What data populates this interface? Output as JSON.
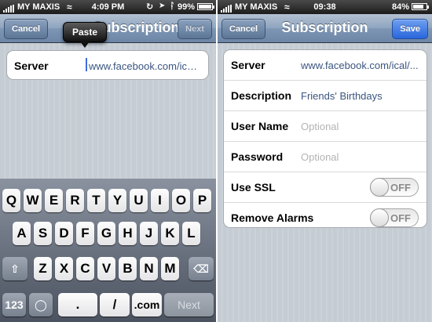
{
  "left": {
    "status": {
      "carrier": "MY MAXIS",
      "time": "4:09 PM",
      "battery": "99%"
    },
    "nav": {
      "title": "Subscription",
      "cancel": "Cancel",
      "next": "Next"
    },
    "server": {
      "label": "Server",
      "value": "www.facebook.com/ical/b.p"
    },
    "paste": "Paste",
    "keyboard": {
      "row1": [
        "Q",
        "W",
        "E",
        "R",
        "T",
        "Y",
        "U",
        "I",
        "O",
        "P"
      ],
      "row2": [
        "A",
        "S",
        "D",
        "F",
        "G",
        "H",
        "J",
        "K",
        "L"
      ],
      "row3": [
        "Z",
        "X",
        "C",
        "V",
        "B",
        "N",
        "M"
      ],
      "numbers": "123",
      "dot": ".",
      "slash": "/",
      "dotcom": ".com",
      "next": "Next"
    }
  },
  "right": {
    "status": {
      "carrier": "MY MAXIS",
      "time": "09:38",
      "battery": "84%"
    },
    "nav": {
      "cancel": "Cancel",
      "title": "Subscription",
      "save": "Save"
    },
    "fields": {
      "server": {
        "label": "Server",
        "value": "www.facebook.com/ical/..."
      },
      "description": {
        "label": "Description",
        "value": "Friends' Birthdays"
      },
      "username": {
        "label": "User Name",
        "placeholder": "Optional"
      },
      "password": {
        "label": "Password",
        "placeholder": "Optional"
      },
      "ssl": {
        "label": "Use SSL",
        "state": "OFF"
      },
      "alarms": {
        "label": "Remove Alarms",
        "state": "OFF"
      }
    }
  },
  "icons": {
    "wifi": "wifi-icon",
    "battery": "battery-icon",
    "bluetooth": "bluetooth-icon",
    "lock": "orientation-lock-icon",
    "delete": "delete-key-icon",
    "shift": "shift-key-icon",
    "globe": "globe-icon"
  },
  "colors": {
    "nav_top": "#b3c1d2",
    "nav_bottom": "#6d86a7",
    "save": "#2966dd",
    "value_text": "#3a5580",
    "placeholder": "#b3b3b3"
  }
}
